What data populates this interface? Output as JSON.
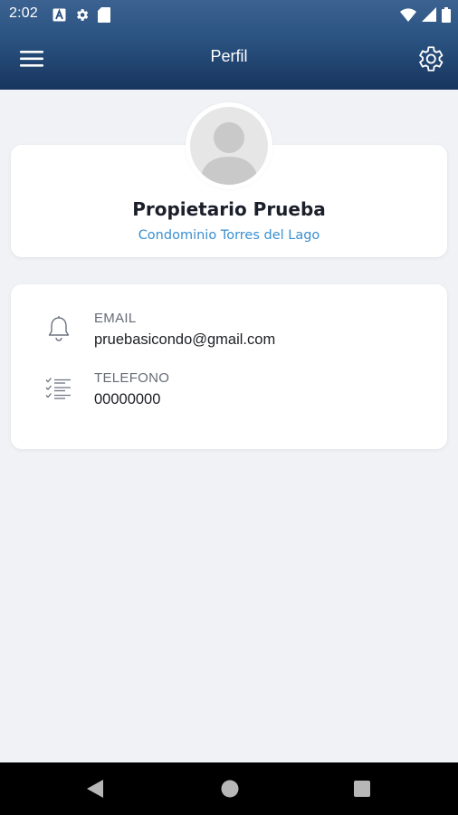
{
  "status_bar": {
    "time": "2:02",
    "icons_left": [
      "font-icon",
      "settings-gear-icon",
      "sd-card-icon"
    ],
    "icons_right": [
      "wifi-icon",
      "signal-icon",
      "battery-icon"
    ]
  },
  "app_bar": {
    "title": "Perfil",
    "menu_icon": "hamburger-menu-icon",
    "settings_icon": "gear-icon"
  },
  "profile": {
    "name": "Propietario Prueba",
    "condominium": "Condominio Torres del Lago",
    "avatar_icon": "default-avatar-icon"
  },
  "info": {
    "email_label": "EMAIL",
    "email_value": "pruebasicondo@gmail.com",
    "email_icon": "bell-icon",
    "phone_label": "TELEFONO",
    "phone_value": "00000000",
    "phone_icon": "checklist-icon"
  },
  "nav_bar": {
    "back_icon": "back-triangle-icon",
    "home_icon": "home-circle-icon",
    "recent_icon": "recent-square-icon"
  },
  "colors": {
    "app_bar_top": "#3b6291",
    "app_bar_bottom": "#17355e",
    "background": "#f0f2f6",
    "accent": "#3a8fd0",
    "name_text": "#1b1f2a"
  }
}
